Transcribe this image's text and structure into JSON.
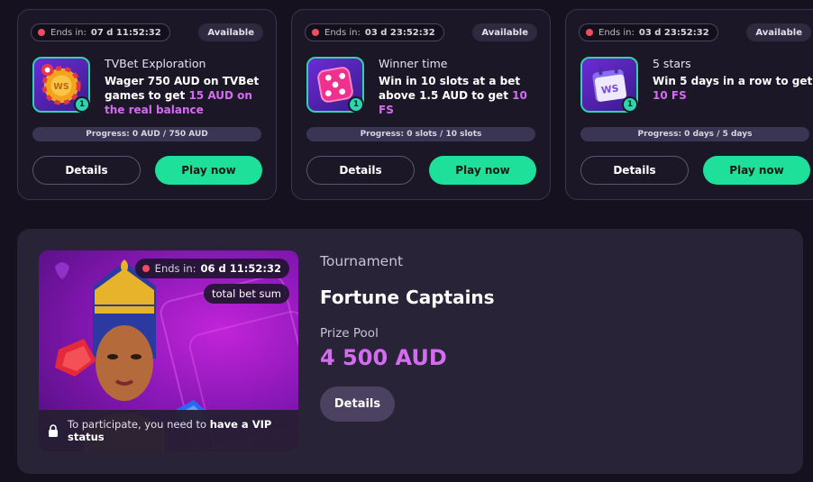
{
  "missions": [
    {
      "ends_label": "Ends in:",
      "ends_value": "07 d 11:52:32",
      "status": "Available",
      "icon": "chip-icon",
      "level": "1",
      "title": "TVBet Exploration",
      "desc_pre": "Wager 750 AUD on TVBet games to get ",
      "desc_hl": "15 AUD on the real balance",
      "progress": "Progress: 0 AUD / 750 AUD",
      "details_label": "Details",
      "play_label": "Play now"
    },
    {
      "ends_label": "Ends in:",
      "ends_value": "03 d 23:52:32",
      "status": "Available",
      "icon": "dice-icon",
      "level": "1",
      "title": "Winner time",
      "desc_pre": "Win in 10 slots at a bet above 1.5 AUD to get ",
      "desc_hl": "10 FS",
      "progress": "Progress: 0 slots / 10 slots",
      "details_label": "Details",
      "play_label": "Play now"
    },
    {
      "ends_label": "Ends in:",
      "ends_value": "03 d 23:52:32",
      "status": "Available",
      "icon": "calendar-icon",
      "level": "1",
      "title": "5 stars",
      "desc_pre": "Win 5 days in a row to get ",
      "desc_hl": "10 FS",
      "progress": "Progress: 0 days / 5 days",
      "details_label": "Details",
      "play_label": "Play now"
    }
  ],
  "tournament": {
    "ends_label": "Ends in:",
    "ends_value": "06 d 11:52:32",
    "type_badge": "total bet sum",
    "vip_pre": "To participate, you need to ",
    "vip_bold": "have a VIP status",
    "category": "Tournament",
    "name": "Fortune Captains",
    "prize_label": "Prize Pool",
    "prize_value": "4 500 AUD",
    "details_label": "Details"
  },
  "colors": {
    "accent_green": "#1fe09b",
    "accent_purple": "#d46cf0",
    "timer_dot": "#ef4c5e"
  }
}
